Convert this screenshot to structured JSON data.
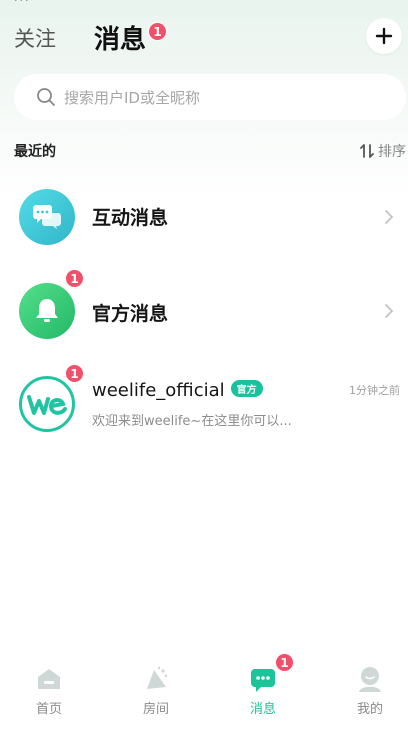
{
  "header": {
    "tab_follow": "关注",
    "tab_messages": "消息",
    "messages_badge": "1"
  },
  "search": {
    "placeholder": "搜索用户ID或全昵称"
  },
  "section": {
    "title": "最近的",
    "sort_label": "排序"
  },
  "rows": [
    {
      "title": "互动消息",
      "icon": "chat-bubbles-icon",
      "color": "#3ec9d8"
    },
    {
      "title": "官方消息",
      "icon": "bell-icon",
      "color": "#34cc72",
      "badge": "1"
    },
    {
      "title": "weelife_official",
      "tag": "官方",
      "preview": "欢迎来到weelife~在这里你可以...",
      "time": "1分钟之前",
      "badge": "1",
      "icon": "weelife-logo"
    }
  ],
  "tabbar": {
    "items": [
      {
        "label": "首页",
        "icon": "home-icon"
      },
      {
        "label": "房间",
        "icon": "room-icon"
      },
      {
        "label": "消息",
        "icon": "message-icon",
        "badge": "1",
        "active": true
      },
      {
        "label": "我的",
        "icon": "profile-icon"
      }
    ],
    "accent": "#1cc49a"
  }
}
